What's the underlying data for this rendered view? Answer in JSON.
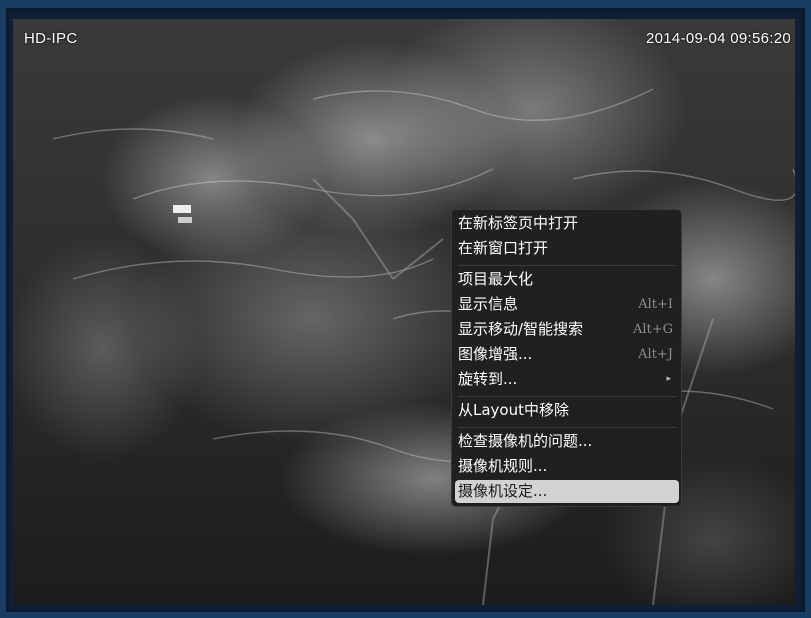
{
  "osd": {
    "camera_name": "HD-IPC",
    "timestamp": "2014-09-04  09:56:20"
  },
  "context_menu": {
    "groups": [
      [
        {
          "label": "在新标签页中打开"
        },
        {
          "label": "在新窗口打开"
        }
      ],
      [
        {
          "label": "项目最大化"
        },
        {
          "label": "显示信息",
          "shortcut": "Alt+I"
        },
        {
          "label": "显示移动/智能搜索",
          "shortcut": "Alt+G"
        },
        {
          "label": "图像增强...",
          "shortcut": "Alt+J"
        },
        {
          "label": "旋转到...",
          "submenu": true
        }
      ],
      [
        {
          "label": "从Layout中移除"
        }
      ],
      [
        {
          "label": "检查摄像机的问题..."
        },
        {
          "label": "摄像机规则..."
        },
        {
          "label": "摄像机设定...",
          "highlighted": true
        }
      ]
    ]
  },
  "icons": {
    "submenu_arrow": "▸"
  },
  "colors": {
    "frame": "#173d64",
    "menu_bg": "#202020",
    "highlight": "#d2d2d2"
  }
}
